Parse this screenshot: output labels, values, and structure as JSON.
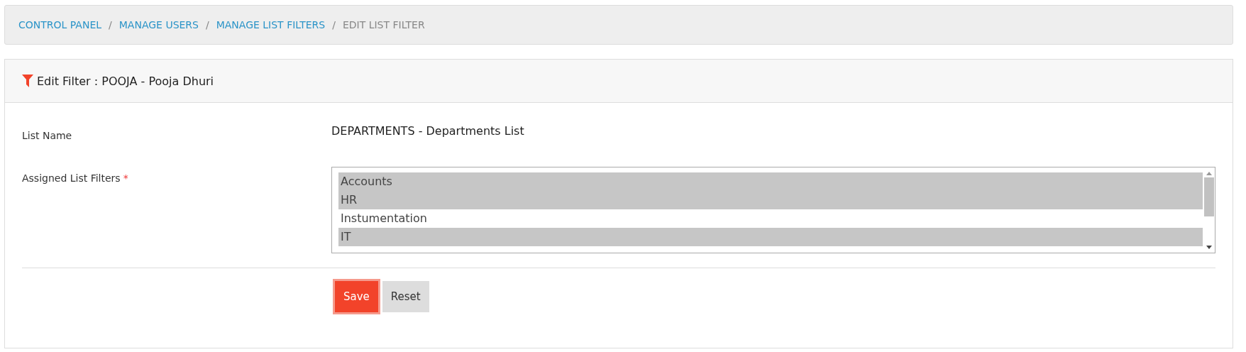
{
  "breadcrumb": [
    {
      "label": "CONTROL PANEL",
      "kind": "link"
    },
    {
      "label": "MANAGE USERS",
      "kind": "link"
    },
    {
      "label": "MANAGE LIST FILTERS",
      "kind": "link"
    },
    {
      "label": "EDIT LIST FILTER",
      "kind": "current"
    }
  ],
  "breadcrumb_separator": "/",
  "panel": {
    "title": "Edit Filter : POOJA - Pooja Dhuri"
  },
  "form": {
    "list_name": {
      "label": "List Name",
      "value": "DEPARTMENTS - Departments List"
    },
    "assigned_list_filters": {
      "label": "Assigned List Filters",
      "required_mark": "*",
      "options": [
        {
          "label": "Accounts",
          "selected": true
        },
        {
          "label": "HR",
          "selected": true
        },
        {
          "label": "Instumentation",
          "selected": false
        },
        {
          "label": "IT",
          "selected": true
        }
      ]
    }
  },
  "buttons": [
    {
      "label": "Save",
      "kind": "primary"
    },
    {
      "label": "Reset",
      "kind": "default"
    }
  ]
}
